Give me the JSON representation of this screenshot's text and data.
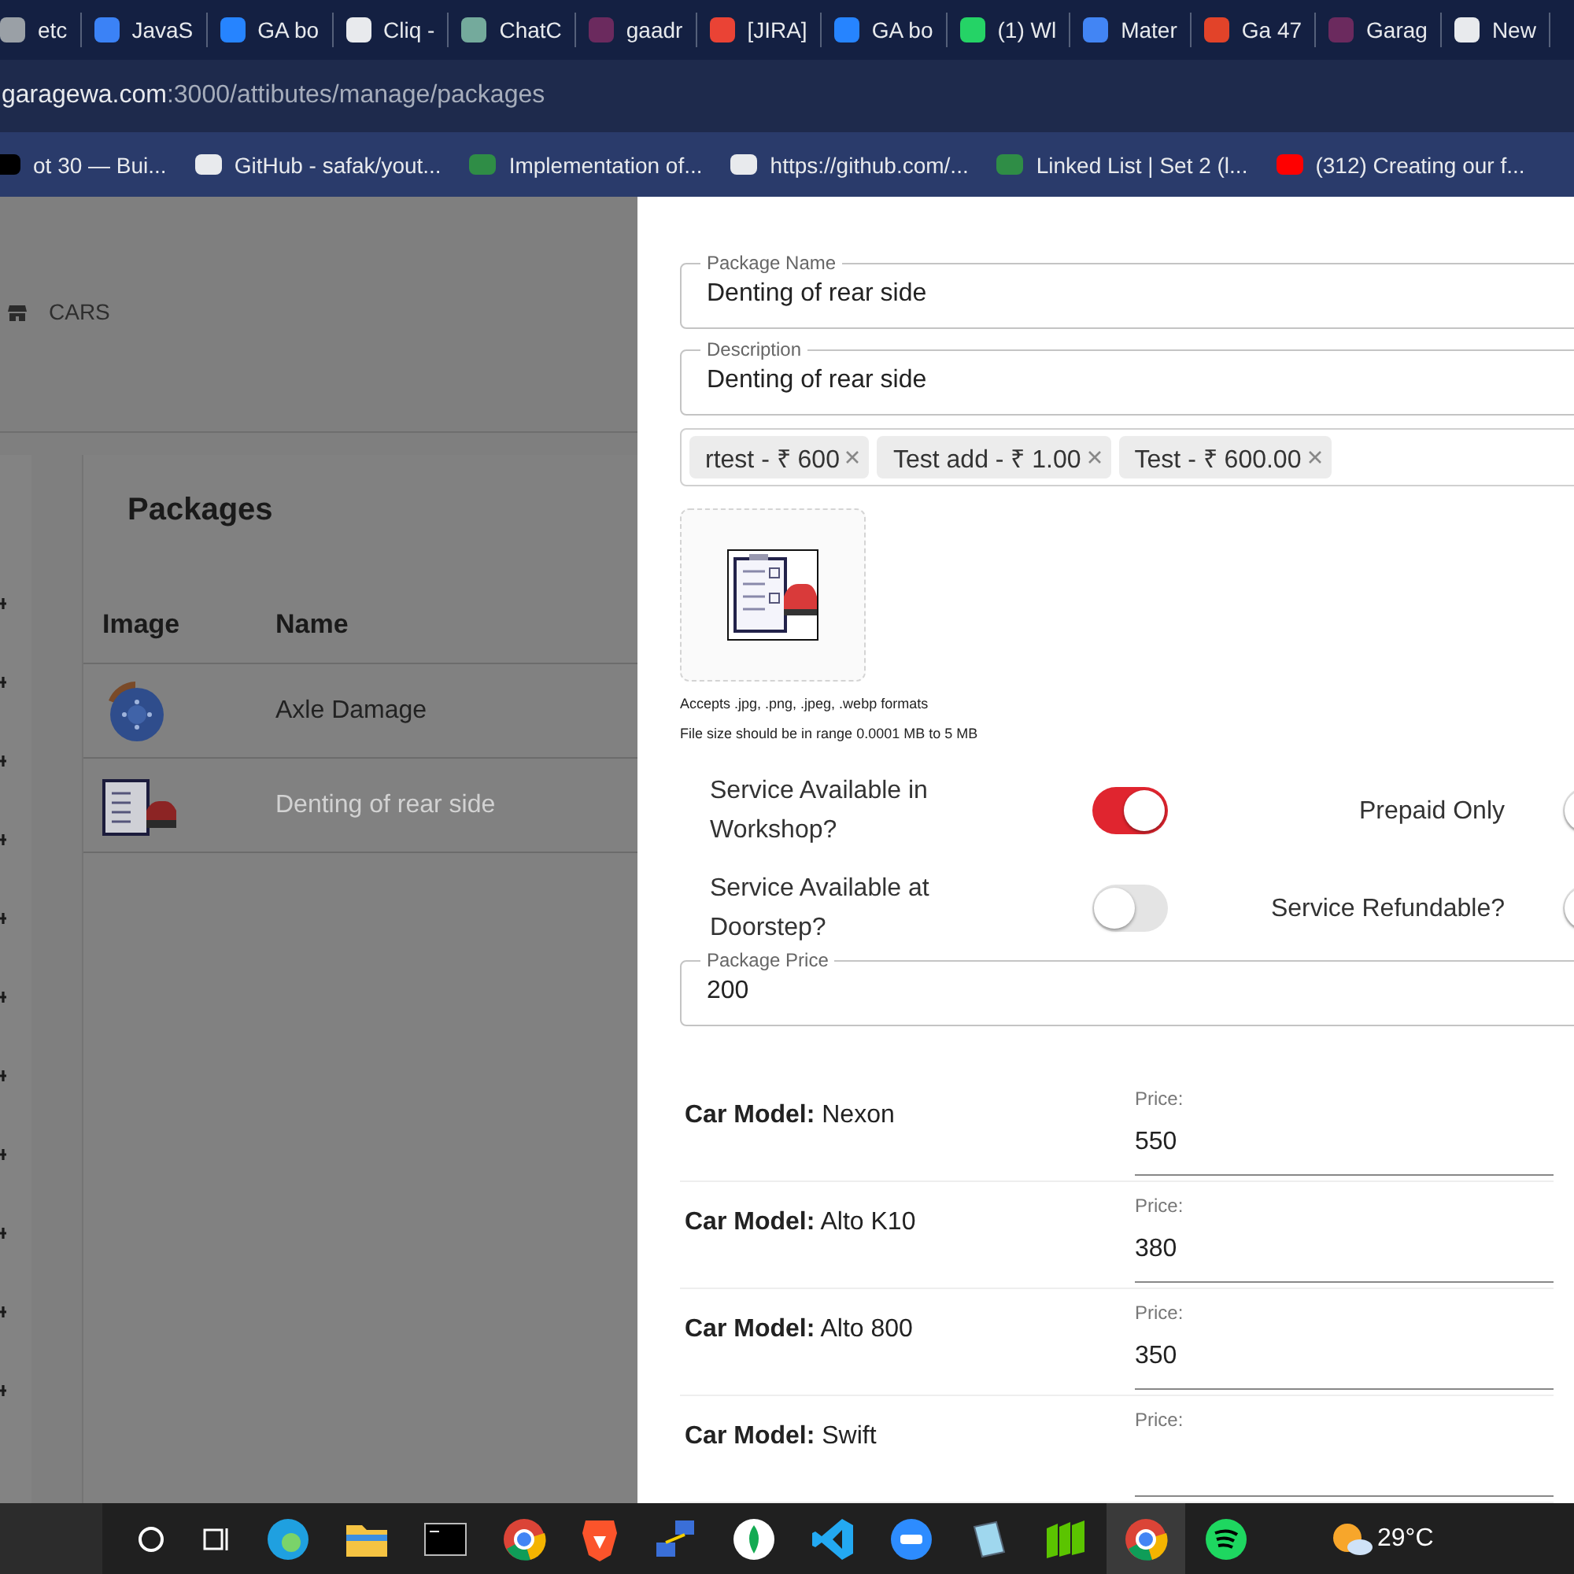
{
  "browser": {
    "tabs": [
      {
        "title": "etc",
        "color": "#9aa0a6"
      },
      {
        "title": "JavaS",
        "color": "#3b82f6"
      },
      {
        "title": "GA bo",
        "color": "#2684ff"
      },
      {
        "title": "Cliq -",
        "color": "#e8eaed"
      },
      {
        "title": "ChatC",
        "color": "#74aa9c"
      },
      {
        "title": "gaadr",
        "color": "#6b2a5e"
      },
      {
        "title": "[JIRA]",
        "color": "#ea4335"
      },
      {
        "title": "GA bo",
        "color": "#2684ff"
      },
      {
        "title": "(1) Wl",
        "color": "#25d366"
      },
      {
        "title": "Mater",
        "color": "#4285f4"
      },
      {
        "title": "Ga 47",
        "color": "#e24329"
      },
      {
        "title": "Garag",
        "color": "#6b2a5e"
      },
      {
        "title": "New",
        "color": "#e8eaed"
      }
    ],
    "address": {
      "host": "garagewa.com",
      "path": ":3000/attibutes/manage/packages"
    },
    "bookmarks": [
      {
        "title": "ot 30 — Bui...",
        "color": "#000000"
      },
      {
        "title": "GitHub - safak/yout...",
        "color": "#e8eaed"
      },
      {
        "title": "Implementation of...",
        "color": "#2f8d46"
      },
      {
        "title": "https://github.com/...",
        "color": "#e8eaed"
      },
      {
        "title": "Linked List | Set 2 (l...",
        "color": "#2f8d46"
      },
      {
        "title": "(312) Creating our f...",
        "color": "#ff0000"
      }
    ]
  },
  "header": {
    "nav_label": "CARS"
  },
  "packages": {
    "title": "Packages",
    "columns": [
      "Image",
      "Name"
    ],
    "rows": [
      {
        "name": "Axle Damage",
        "kind": "brake",
        "inactive": false
      },
      {
        "name": "Denting of rear side",
        "kind": "checklist",
        "inactive": true
      }
    ]
  },
  "form": {
    "package_name": {
      "label": "Package Name",
      "value": "Denting of rear side"
    },
    "description": {
      "label": "Description",
      "value": "Denting of rear side"
    },
    "chips": [
      "rtest - ₹ 600",
      "Test add - ₹ 1.00",
      "Test - ₹ 600.00"
    ],
    "upload_hints": [
      "Accepts .jpg, .png, .jpeg, .webp formats",
      "File size should be in range 0.0001 MB to 5 MB"
    ],
    "toggles": [
      {
        "label": "Service Available in Workshop?",
        "on": true
      },
      {
        "label": "Prepaid Only",
        "on": false
      },
      {
        "label": "Service Available at Doorstep?",
        "on": false
      },
      {
        "label": "Service Refundable?",
        "on": false
      }
    ],
    "package_price": {
      "label": "Package Price",
      "value": "200"
    },
    "car_models": [
      {
        "label": "Car Model:",
        "model": "Nexon",
        "price_label": "Price:",
        "price": "550"
      },
      {
        "label": "Car Model:",
        "model": "Alto K10",
        "price_label": "Price:",
        "price": "380"
      },
      {
        "label": "Car Model:",
        "model": "Alto 800",
        "price_label": "Price:",
        "price": "350"
      },
      {
        "label": "Car Model:",
        "model": "Swift",
        "price_label": "Price:"
      }
    ]
  },
  "taskbar": {
    "weather": "29°C"
  }
}
